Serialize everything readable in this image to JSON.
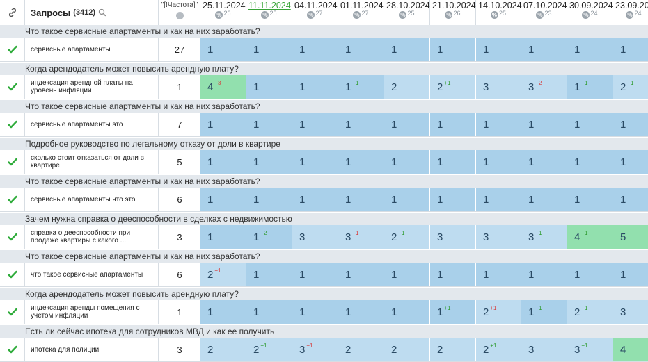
{
  "header": {
    "query_title": "Запросы",
    "query_count": "(3412)",
    "freq_label": "\"[!Частота]\"",
    "dates": [
      {
        "date": "25.11.2024",
        "pct": "%",
        "num": "26",
        "active": false
      },
      {
        "date": "11.11.2024",
        "pct": "%",
        "num": "25",
        "active": true
      },
      {
        "date": "04.11.2024",
        "pct": "%",
        "num": "27",
        "active": false
      },
      {
        "date": "01.11.2024",
        "pct": "%",
        "num": "27",
        "active": false
      },
      {
        "date": "28.10.2024",
        "pct": "%",
        "num": "25",
        "active": false
      },
      {
        "date": "21.10.2024",
        "pct": "%",
        "num": "26",
        "active": false
      },
      {
        "date": "14.10.2024",
        "pct": "%",
        "num": "25",
        "active": false
      },
      {
        "date": "07.10.2024",
        "pct": "%",
        "num": "23",
        "active": false
      },
      {
        "date": "30.09.2024",
        "pct": "%",
        "num": "24",
        "active": false
      },
      {
        "date": "23.09.20",
        "pct": "%",
        "num": "24",
        "active": false
      }
    ]
  },
  "rows": [
    {
      "group": "Что такое сервисные апартаменты и как на них заработать?",
      "query": "сервисные апартаменты",
      "freq": "27",
      "cells": [
        {
          "v": "1",
          "d": "",
          "s": "top"
        },
        {
          "v": "1",
          "d": "",
          "s": "top"
        },
        {
          "v": "1",
          "d": "",
          "s": "top"
        },
        {
          "v": "1",
          "d": "",
          "s": "top"
        },
        {
          "v": "1",
          "d": "",
          "s": "top"
        },
        {
          "v": "1",
          "d": "",
          "s": "top"
        },
        {
          "v": "1",
          "d": "",
          "s": "top"
        },
        {
          "v": "1",
          "d": "",
          "s": "top"
        },
        {
          "v": "1",
          "d": "",
          "s": "top"
        },
        {
          "v": "1",
          "d": "",
          "s": "top"
        }
      ]
    },
    {
      "group": "Когда арендодатель может повысить арендную плату?",
      "query": "индексация арендной платы на уровень инфляции",
      "freq": "1",
      "cells": [
        {
          "v": "4",
          "d": "+3",
          "dir": "down",
          "s": "green"
        },
        {
          "v": "1",
          "d": "",
          "s": "top"
        },
        {
          "v": "1",
          "d": "",
          "s": "top"
        },
        {
          "v": "1",
          "d": "+1",
          "dir": "up",
          "s": "top"
        },
        {
          "v": "2",
          "d": "",
          "s": "mid"
        },
        {
          "v": "2",
          "d": "+1",
          "dir": "up",
          "s": "mid"
        },
        {
          "v": "3",
          "d": "",
          "s": "mid"
        },
        {
          "v": "3",
          "d": "+2",
          "dir": "down",
          "s": "mid"
        },
        {
          "v": "1",
          "d": "+1",
          "dir": "up",
          "s": "top"
        },
        {
          "v": "2",
          "d": "+1",
          "dir": "up",
          "s": "mid"
        }
      ]
    },
    {
      "group": "Что такое сервисные апартаменты и как на них заработать?",
      "query": "сервисные апартаменты это",
      "freq": "7",
      "cells": [
        {
          "v": "1",
          "d": "",
          "s": "top"
        },
        {
          "v": "1",
          "d": "",
          "s": "top"
        },
        {
          "v": "1",
          "d": "",
          "s": "top"
        },
        {
          "v": "1",
          "d": "",
          "s": "top"
        },
        {
          "v": "1",
          "d": "",
          "s": "top"
        },
        {
          "v": "1",
          "d": "",
          "s": "top"
        },
        {
          "v": "1",
          "d": "",
          "s": "top"
        },
        {
          "v": "1",
          "d": "",
          "s": "top"
        },
        {
          "v": "1",
          "d": "",
          "s": "top"
        },
        {
          "v": "1",
          "d": "",
          "s": "top"
        }
      ]
    },
    {
      "group": "Подробное руководство по легальному отказу от доли в квартире",
      "query": "сколько стоит отказаться от доли в квартире",
      "freq": "5",
      "cells": [
        {
          "v": "1",
          "d": "",
          "s": "top"
        },
        {
          "v": "1",
          "d": "",
          "s": "top"
        },
        {
          "v": "1",
          "d": "",
          "s": "top"
        },
        {
          "v": "1",
          "d": "",
          "s": "top"
        },
        {
          "v": "1",
          "d": "",
          "s": "top"
        },
        {
          "v": "1",
          "d": "",
          "s": "top"
        },
        {
          "v": "1",
          "d": "",
          "s": "top"
        },
        {
          "v": "1",
          "d": "",
          "s": "top"
        },
        {
          "v": "1",
          "d": "",
          "s": "top"
        },
        {
          "v": "1",
          "d": "",
          "s": "top"
        }
      ]
    },
    {
      "group": "Что такое сервисные апартаменты и как на них заработать?",
      "query": "сервисные апартаменты что это",
      "freq": "6",
      "cells": [
        {
          "v": "1",
          "d": "",
          "s": "top"
        },
        {
          "v": "1",
          "d": "",
          "s": "top"
        },
        {
          "v": "1",
          "d": "",
          "s": "top"
        },
        {
          "v": "1",
          "d": "",
          "s": "top"
        },
        {
          "v": "1",
          "d": "",
          "s": "top"
        },
        {
          "v": "1",
          "d": "",
          "s": "top"
        },
        {
          "v": "1",
          "d": "",
          "s": "top"
        },
        {
          "v": "1",
          "d": "",
          "s": "top"
        },
        {
          "v": "1",
          "d": "",
          "s": "top"
        },
        {
          "v": "1",
          "d": "",
          "s": "top"
        }
      ]
    },
    {
      "group": "Зачем нужна справка о дееспособности в сделках с недвижимостью",
      "query": "справка о дееспособности при продаже квартиры с какого ...",
      "freq": "3",
      "cells": [
        {
          "v": "1",
          "d": "",
          "s": "top"
        },
        {
          "v": "1",
          "d": "+2",
          "dir": "up",
          "s": "top"
        },
        {
          "v": "3",
          "d": "",
          "s": "mid"
        },
        {
          "v": "3",
          "d": "+1",
          "dir": "down",
          "s": "mid"
        },
        {
          "v": "2",
          "d": "+1",
          "dir": "up",
          "s": "mid"
        },
        {
          "v": "3",
          "d": "",
          "s": "mid"
        },
        {
          "v": "3",
          "d": "",
          "s": "mid"
        },
        {
          "v": "3",
          "d": "+1",
          "dir": "up",
          "s": "mid"
        },
        {
          "v": "4",
          "d": "+1",
          "dir": "up",
          "s": "green"
        },
        {
          "v": "5",
          "d": "",
          "s": "green"
        }
      ]
    },
    {
      "group": "Что такое сервисные апартаменты и как на них заработать?",
      "query": "что такое сервисные апартаменты",
      "freq": "6",
      "cells": [
        {
          "v": "2",
          "d": "+1",
          "dir": "down",
          "s": "mid"
        },
        {
          "v": "1",
          "d": "",
          "s": "top"
        },
        {
          "v": "1",
          "d": "",
          "s": "top"
        },
        {
          "v": "1",
          "d": "",
          "s": "top"
        },
        {
          "v": "1",
          "d": "",
          "s": "top"
        },
        {
          "v": "1",
          "d": "",
          "s": "top"
        },
        {
          "v": "1",
          "d": "",
          "s": "top"
        },
        {
          "v": "1",
          "d": "",
          "s": "top"
        },
        {
          "v": "1",
          "d": "",
          "s": "top"
        },
        {
          "v": "1",
          "d": "",
          "s": "top"
        }
      ]
    },
    {
      "group": "Когда арендодатель может повысить арендную плату?",
      "query": "индексация аренды помещения с учетом инфляции",
      "freq": "1",
      "cells": [
        {
          "v": "1",
          "d": "",
          "s": "top"
        },
        {
          "v": "1",
          "d": "",
          "s": "top"
        },
        {
          "v": "1",
          "d": "",
          "s": "top"
        },
        {
          "v": "1",
          "d": "",
          "s": "top"
        },
        {
          "v": "1",
          "d": "",
          "s": "top"
        },
        {
          "v": "1",
          "d": "+1",
          "dir": "up",
          "s": "top"
        },
        {
          "v": "2",
          "d": "+1",
          "dir": "down",
          "s": "mid"
        },
        {
          "v": "1",
          "d": "+1",
          "dir": "up",
          "s": "top"
        },
        {
          "v": "2",
          "d": "+1",
          "dir": "up",
          "s": "mid"
        },
        {
          "v": "3",
          "d": "",
          "s": "mid"
        }
      ]
    },
    {
      "group": "Есть ли сейчас ипотека для сотрудников МВД и как ее получить",
      "query": "ипотека для полиции",
      "freq": "3",
      "cells": [
        {
          "v": "2",
          "d": "",
          "s": "mid"
        },
        {
          "v": "2",
          "d": "+1",
          "dir": "up",
          "s": "mid"
        },
        {
          "v": "3",
          "d": "+1",
          "dir": "down",
          "s": "mid"
        },
        {
          "v": "2",
          "d": "",
          "s": "mid"
        },
        {
          "v": "2",
          "d": "",
          "s": "mid"
        },
        {
          "v": "2",
          "d": "",
          "s": "mid"
        },
        {
          "v": "2",
          "d": "+1",
          "dir": "up",
          "s": "mid"
        },
        {
          "v": "3",
          "d": "",
          "s": "mid"
        },
        {
          "v": "3",
          "d": "+1",
          "dir": "up",
          "s": "mid"
        },
        {
          "v": "4",
          "d": "",
          "s": "green"
        }
      ]
    }
  ],
  "colors": {
    "top": "#a9d0ea",
    "mid": "#bedcf0",
    "green": "#92e0ae",
    "check": "#2eab3a"
  }
}
